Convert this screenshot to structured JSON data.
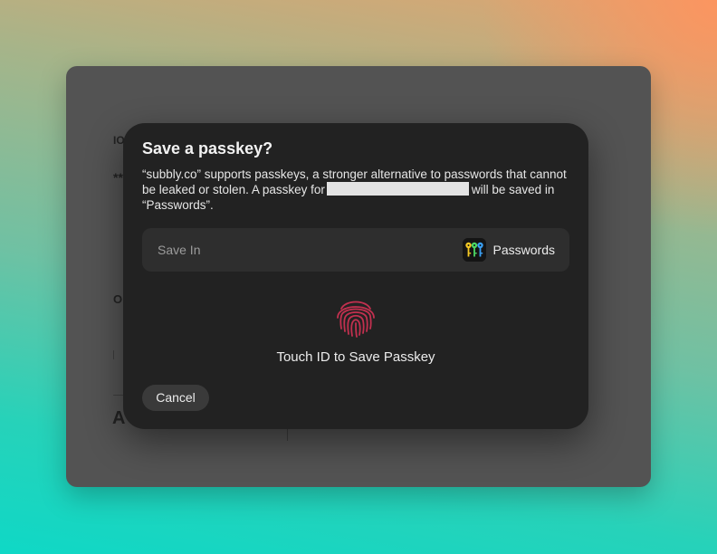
{
  "background_window": {
    "fragments": [
      "IO",
      "**",
      "O",
      "A"
    ]
  },
  "dialog": {
    "title": "Save a passkey?",
    "message_part1": "“subbly.co” supports passkeys, a stronger alternative to passwords that cannot be leaked or stolen. A passkey for",
    "message_part2": "will be saved in “Passwords”.",
    "save_in": {
      "label": "Save In",
      "app_name": "Passwords",
      "app_icon": "passwords-keys-icon"
    },
    "touch_id": {
      "icon": "fingerprint-icon",
      "label": "Touch ID to Save Passkey"
    },
    "cancel_label": "Cancel"
  },
  "colors": {
    "dialog_bg": "#222222",
    "row_bg": "#2e2e2e",
    "fingerprint": "#c2304f",
    "button_bg": "#3a3a3a",
    "redaction": "#e3e3e3"
  }
}
